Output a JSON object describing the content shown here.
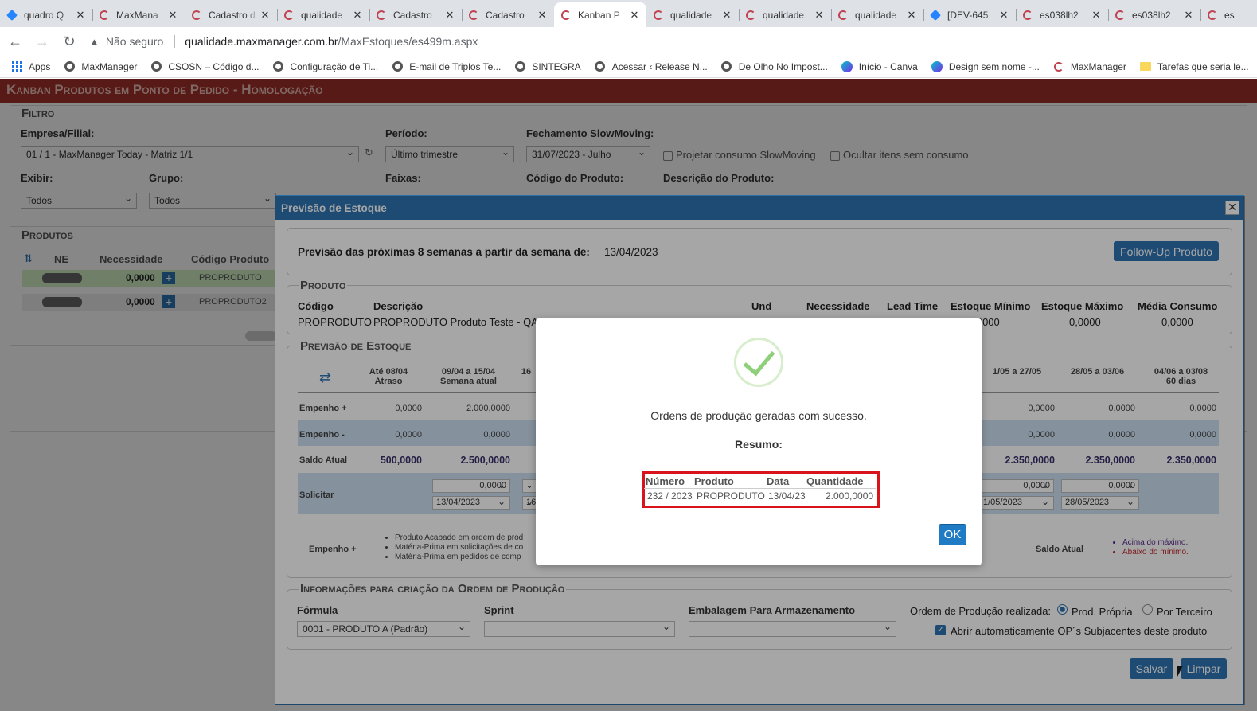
{
  "browser": {
    "tabs": [
      {
        "title": "quadro Q",
        "icon": "jira-icon"
      },
      {
        "title": "MaxMana",
        "icon": "maxmanager-icon"
      },
      {
        "title": "Cadastro d",
        "icon": "maxmanager-icon"
      },
      {
        "title": "qualidade",
        "icon": "maxmanager-icon"
      },
      {
        "title": "Cadastro",
        "icon": "maxmanager-icon"
      },
      {
        "title": "Cadastro",
        "icon": "maxmanager-icon"
      },
      {
        "title": "Kanban P",
        "icon": "maxmanager-icon",
        "active": true
      },
      {
        "title": "qualidade",
        "icon": "maxmanager-icon"
      },
      {
        "title": "qualidade",
        "icon": "maxmanager-icon"
      },
      {
        "title": "qualidade",
        "icon": "maxmanager-icon"
      },
      {
        "title": "[DEV-645",
        "icon": "jira-icon"
      },
      {
        "title": "es038lh2",
        "icon": "maxmanager-icon"
      },
      {
        "title": "es038lh2",
        "icon": "maxmanager-icon"
      },
      {
        "title": "es",
        "icon": "maxmanager-icon"
      }
    ],
    "close_glyph": "✕",
    "omnibox": {
      "security_label": "Não seguro",
      "host": "qualidade.maxmanager.com.br",
      "path": "/MaxEstoques/es499m.aspx"
    },
    "bookmarks": [
      {
        "label": "Apps",
        "icon": "apps-icon"
      },
      {
        "label": "MaxManager",
        "icon": "globe-icon"
      },
      {
        "label": "CSOSN – Código d...",
        "icon": "globe-icon"
      },
      {
        "label": "Configuração de Ti...",
        "icon": "globe-icon"
      },
      {
        "label": "E-mail de Triplos Te...",
        "icon": "globe-icon"
      },
      {
        "label": "SINTEGRA",
        "icon": "globe-icon"
      },
      {
        "label": "Acessar ‹ Release N...",
        "icon": "globe-icon"
      },
      {
        "label": "De Olho No Impost...",
        "icon": "globe-icon"
      },
      {
        "label": "Início - Canva",
        "icon": "canva-icon"
      },
      {
        "label": "Design sem nome -...",
        "icon": "canva-icon"
      },
      {
        "label": "MaxManager",
        "icon": "maxmanager-icon"
      },
      {
        "label": "Tarefas que seria le...",
        "icon": "folder-icon"
      }
    ]
  },
  "page": {
    "title": "Kanban Produtos em Ponto de Pedido  - Homologação",
    "filtro": {
      "legend": "Filtro",
      "empresa_label": "Empresa/Filial:",
      "empresa_value": "01 / 1 - MaxManager Today - Matriz 1/1",
      "periodo_label": "Período:",
      "periodo_value": "Último trimestre",
      "fechamento_label": "Fechamento SlowMoving:",
      "fechamento_value": "31/07/2023 - Julho",
      "projetar_label": "Projetar consumo SlowMoving",
      "ocultar_label": "Ocultar itens sem consumo",
      "exibir_label": "Exibir:",
      "exibir_value": "Todos",
      "grupo_label": "Grupo:",
      "grupo_value": "Todos",
      "faixas_label": "Faixas:",
      "codigo_label": "Código do Produto:",
      "descricao_label": "Descrição do Produto:"
    },
    "produtos": {
      "legend": "Produtos",
      "columns": [
        "NE",
        "Necessidade",
        "Código Produto"
      ],
      "rows": [
        {
          "necessidade": "0,0000",
          "codigo": "PROPRODUTO"
        },
        {
          "necessidade": "0,0000",
          "codigo": "PROPRODUTO2"
        }
      ]
    }
  },
  "modal": {
    "title": "Previsão de Estoque",
    "close_glyph": "✕",
    "previsao_label": "Previsão das próximas 8 semanas a partir da semana de:",
    "previsao_date": "13/04/2023",
    "follow_up_button": "Follow-Up Produto",
    "produto": {
      "legend": "Produto",
      "headers": [
        "Código",
        "Descrição",
        "Und",
        "Necessidade",
        "Lead Time",
        "Estoque Mínimo",
        "Estoque Máximo",
        "Média Consumo"
      ],
      "codigo": "PROPRODUTO",
      "descricao": "PROPRODUTO Produto Teste - QA",
      "estoque_minimo": "0,0000",
      "estoque_maximo": "0,0000",
      "media_consumo": "0,0000"
    },
    "previsao": {
      "legend": "Previsão de Estoque",
      "col_headers": [
        {
          "line1": "Até 08/04",
          "line2": "Atraso"
        },
        {
          "line1": "09/04 a 15/04",
          "line2": "Semana atual"
        },
        {
          "line1": "16",
          "line2": ""
        },
        {
          "line1": "1/05 a 27/05",
          "line2": ""
        },
        {
          "line1": "28/05 a 03/06",
          "line2": ""
        },
        {
          "line1": "04/06 a 03/08",
          "line2": "60 dias"
        }
      ],
      "rows": {
        "empenho_plus": {
          "label": "Empenho +",
          "values": [
            "0,0000",
            "2.000,0000",
            "0,0000",
            "0,0000",
            "0,0000"
          ]
        },
        "empenho_minus": {
          "label": "Empenho -",
          "values": [
            "0,0000",
            "0,0000",
            "0,0000",
            "0,0000",
            "0,0000"
          ]
        },
        "saldo_atual": {
          "label": "Saldo Atual",
          "values": [
            "500,0000",
            "2.500,0000",
            "2.350,0000",
            "2.350,0000",
            "2.350,0000"
          ]
        },
        "solicitar": {
          "label": "Solicitar",
          "qty": [
            "0,0000",
            "0,0000",
            "0,0000"
          ],
          "dates": [
            "13/04/2023",
            "16",
            "1/05/2023",
            "28/05/2023"
          ]
        }
      },
      "legend_empenho": "Empenho +",
      "legend_items": [
        "Produto Acabado em ordem de prod",
        "Matéria-Prima em solicitações de co",
        "Matéria-Prima em pedidos de comp"
      ],
      "legend_saldo": "Saldo Atual",
      "legend_saldo_items": [
        "Acima do máximo.",
        "Abaixo do mínimo."
      ]
    },
    "info_op": {
      "legend": "Informações para criação da Ordem de Produção",
      "formula_label": "Fórmula",
      "formula_value": "0001 - PRODUTO A (Padrão)",
      "sprint_label": "Sprint",
      "sprint_value": "",
      "embalagem_label": "Embalagem Para Armazenamento",
      "embalagem_value": "",
      "op_realizada_label": "Ordem de Produção realizada:",
      "radio_propria": "Prod. Própria",
      "radio_terceiro": "Por Terceiro",
      "abrir_label": "Abrir automaticamente OP´s Subjacentes deste produto"
    },
    "salvar_button": "Salvar",
    "limpar_button": "Limpar"
  },
  "dialog": {
    "message": "Ordens de produção geradas com sucesso.",
    "resumo_label": "Resumo:",
    "table": {
      "headers": [
        "Número",
        "Produto",
        "Data",
        "Quantidade"
      ],
      "row": [
        "232 / 2023",
        "PROPRODUTO",
        "13/04/23",
        "2.000,0000"
      ]
    },
    "ok_button": "OK"
  },
  "colors": {
    "header_red": "#a4312c",
    "modal_blue": "#2d74b3",
    "ok_blue": "#1f7cc4",
    "highlight_red": "#d8131b",
    "success_green": "#8ed07a"
  }
}
